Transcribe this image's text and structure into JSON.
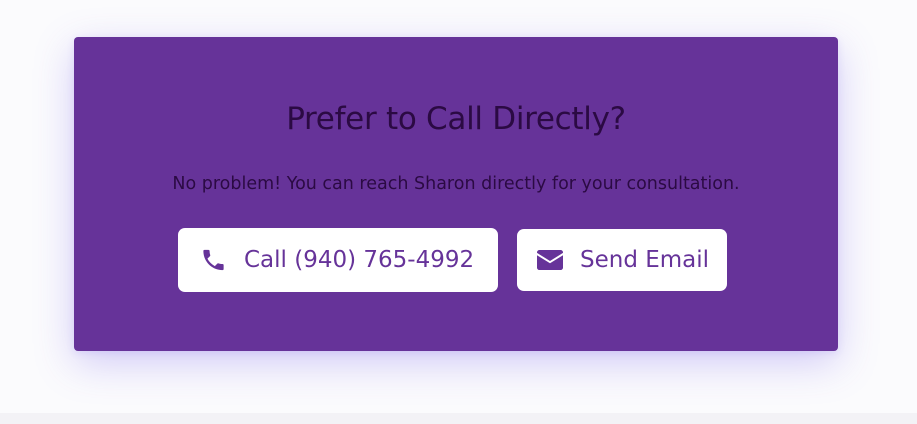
{
  "cta": {
    "title": "Prefer to Call Directly?",
    "subtitle": "No problem! You can reach Sharon directly for your consultation.",
    "call_button": {
      "label": "Call (940) 765-4992",
      "icon": "phone-icon"
    },
    "email_button": {
      "label": "Send Email",
      "icon": "envelope-icon"
    }
  },
  "colors": {
    "card_background": "#663399",
    "heading_text": "#2b0a43",
    "button_background": "#ffffff",
    "button_text": "#663399",
    "page_background": "#fbfbfd"
  }
}
